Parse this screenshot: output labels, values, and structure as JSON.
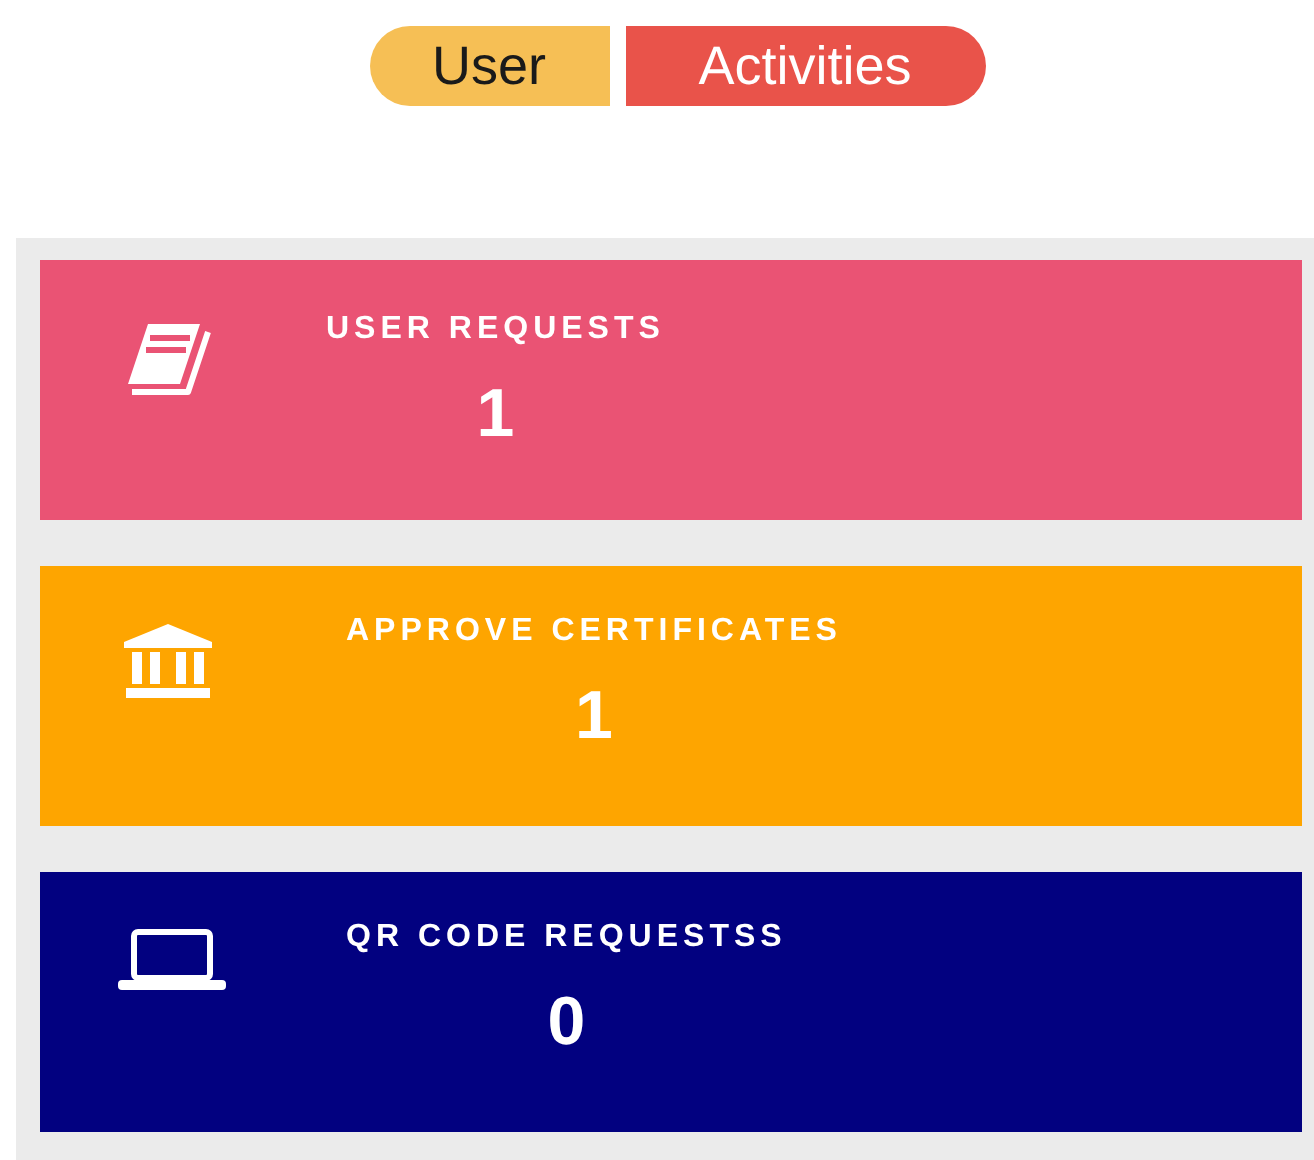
{
  "toggle": [
    {
      "label": "User",
      "color": "#f6bf55"
    },
    {
      "label": "Activities",
      "color": "#e9534a"
    }
  ],
  "cards": [
    {
      "title": "USER REQUESTS",
      "count": "1",
      "color": "#ea5374"
    },
    {
      "title": "APPROVE CERTIFICATES",
      "count": "1",
      "color": "#fea500"
    },
    {
      "title": "QR CODE REQUESTSS",
      "count": "0",
      "color": "#020180"
    }
  ]
}
